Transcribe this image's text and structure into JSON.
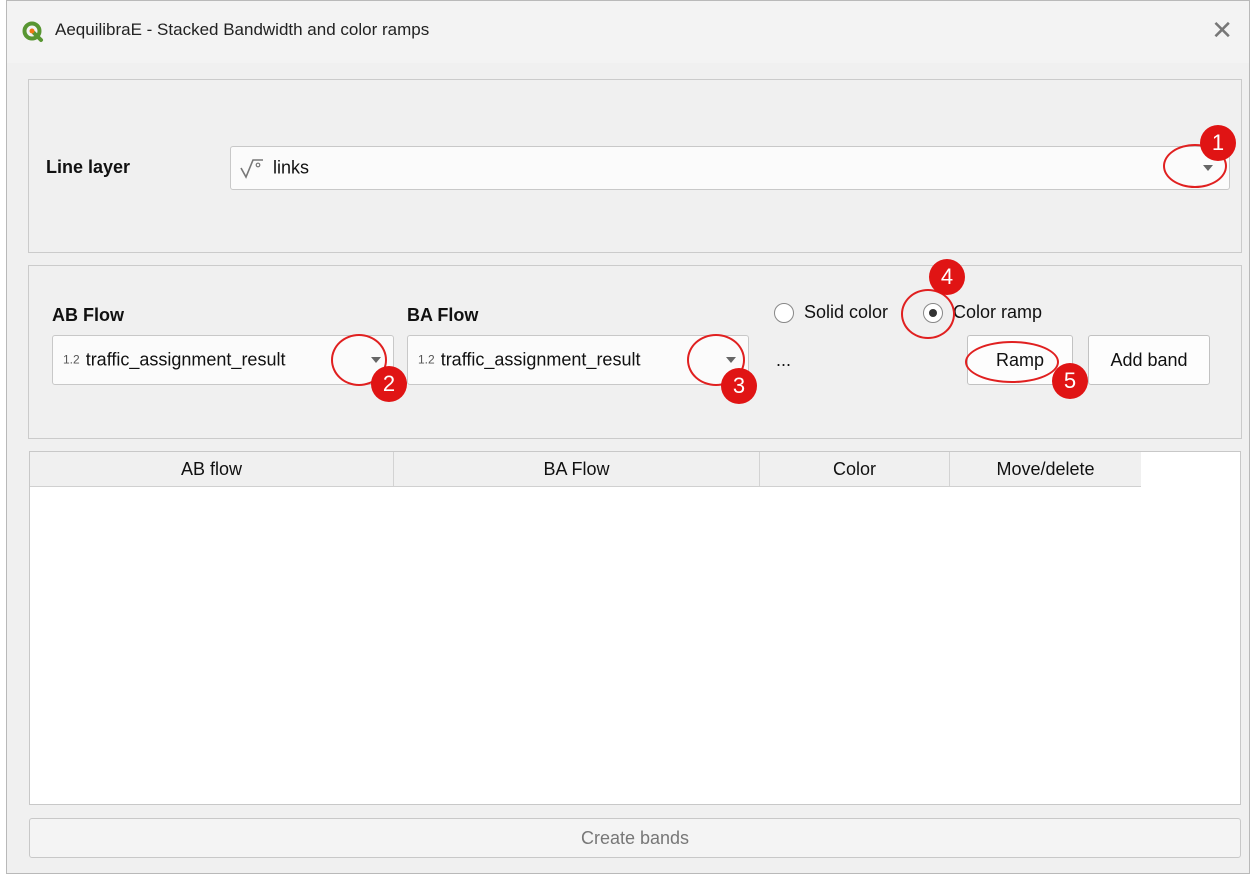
{
  "window": {
    "title": "AequilibraE - Stacked Bandwidth and color ramps",
    "close_glyph": "✕"
  },
  "layer_group": {
    "label": "Line layer",
    "combo": {
      "icon": "line-layer-icon",
      "value": "links"
    }
  },
  "flow_group": {
    "ab_label": "AB Flow",
    "ba_label": "BA Flow",
    "ab_combo": {
      "type_badge": "1.2",
      "value": "traffic_assignment_result"
    },
    "ba_combo": {
      "type_badge": "1.2",
      "value": "traffic_assignment_result"
    },
    "more": "...",
    "radio_solid": {
      "label": "Solid color",
      "checked": false
    },
    "radio_ramp": {
      "label": "Color ramp",
      "checked": true
    },
    "ramp_button": "Ramp",
    "add_band_button": "Add band"
  },
  "table": {
    "columns": [
      "AB flow",
      "BA Flow",
      "Color",
      "Move/delete"
    ],
    "rows": []
  },
  "create_button": "Create bands",
  "annotations": {
    "markers": [
      "1",
      "2",
      "3",
      "4",
      "5"
    ],
    "color": "#e01414"
  }
}
